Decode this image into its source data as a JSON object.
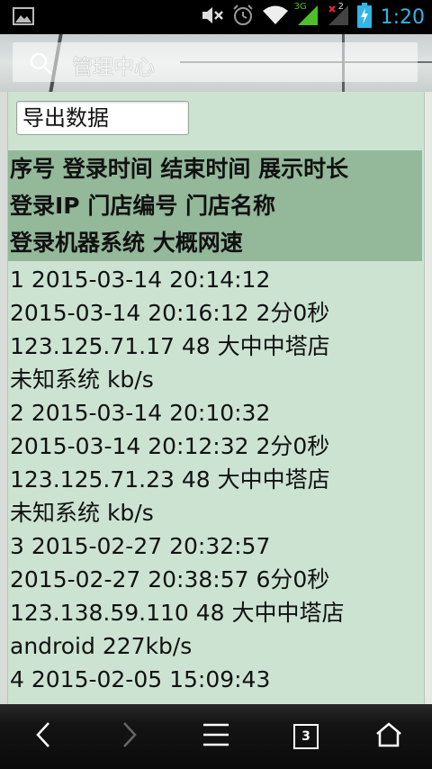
{
  "status_bar": {
    "time": "1:20",
    "network_label": "3G",
    "sim2_label": "2",
    "icons": [
      "image-icon",
      "mute-icon",
      "alarm-icon",
      "wifi-icon",
      "signal-icon",
      "battery-icon"
    ]
  },
  "address_bar": {
    "text": "管理中心"
  },
  "page": {
    "export_label": "导出数据",
    "header_lines": [
      "序号 登录时间 结束时间 展示时长",
      "登录IP 门店编号 门店名称",
      "登录机器系统 大概网速"
    ],
    "lines": [
      "1 2015-03-14 20:14:12",
      "2015-03-14 20:16:12 2分0秒",
      "123.125.71.17 48 大中中塔店",
      "未知系统 kb/s",
      "2 2015-03-14 20:10:32",
      "2015-03-14 20:12:32 2分0秒",
      "123.125.71.23 48 大中中塔店",
      "未知系统 kb/s",
      "3 2015-02-27 20:32:57",
      "2015-02-27 20:38:57 6分0秒",
      "123.138.59.110 48 大中中塔店",
      "android 227kb/s",
      "4 2015-02-05 15:09:43"
    ]
  },
  "navbar": {
    "tab_count": "3",
    "icons": [
      "back-icon",
      "forward-icon",
      "menu-icon",
      "tabs-icon",
      "home-icon"
    ]
  },
  "colors": {
    "content_bg": "#cce3d2",
    "header_bg": "#93b89a",
    "status_accent": "#33b5e5"
  }
}
